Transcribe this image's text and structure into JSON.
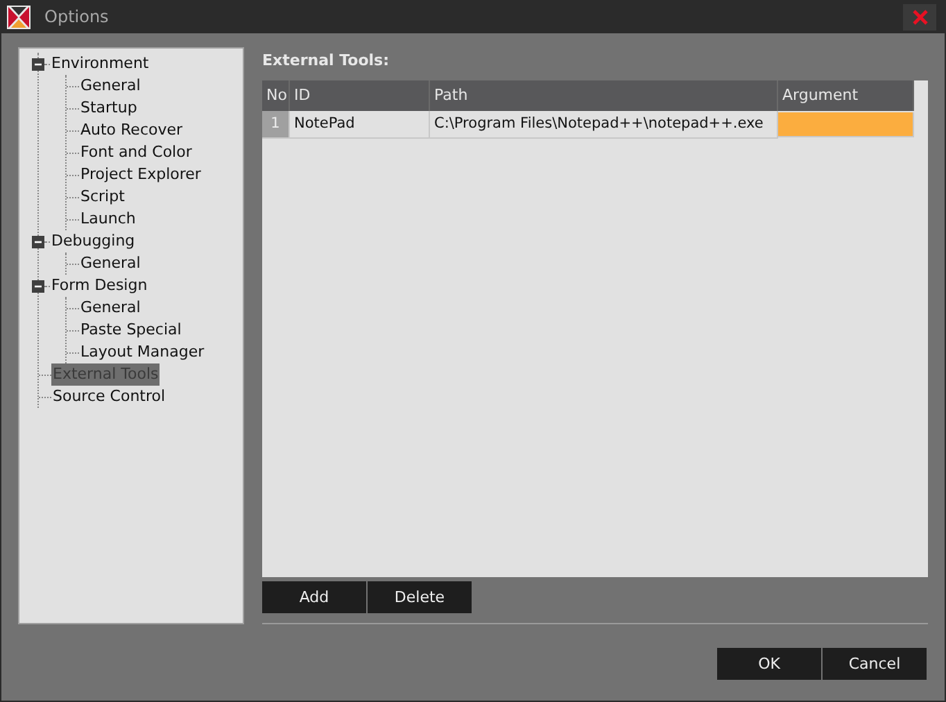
{
  "window": {
    "title": "Options"
  },
  "tree": [
    {
      "label": "Environment",
      "expanded": true,
      "selected": false,
      "children": [
        {
          "label": "General",
          "selected": false
        },
        {
          "label": "Startup",
          "selected": false
        },
        {
          "label": "Auto Recover",
          "selected": false
        },
        {
          "label": "Font and Color",
          "selected": false
        },
        {
          "label": "Project Explorer",
          "selected": false
        },
        {
          "label": "Script",
          "selected": false
        },
        {
          "label": "Launch",
          "selected": false
        }
      ]
    },
    {
      "label": "Debugging",
      "expanded": true,
      "selected": false,
      "children": [
        {
          "label": "General",
          "selected": false
        }
      ]
    },
    {
      "label": "Form Design",
      "expanded": true,
      "selected": false,
      "children": [
        {
          "label": "General",
          "selected": false
        },
        {
          "label": "Paste Special",
          "selected": false
        },
        {
          "label": "Layout Manager",
          "selected": false
        }
      ]
    },
    {
      "label": "External Tools",
      "selected": true
    },
    {
      "label": "Source Control",
      "selected": false
    }
  ],
  "section_title": "External Tools:",
  "table": {
    "columns": [
      "No",
      "ID",
      "Path",
      "Argument"
    ],
    "rows": [
      {
        "no": "1",
        "id": "NotePad",
        "path": "C:\\Program Files\\Notepad++\\notepad++.exe",
        "argument_selected": true
      }
    ]
  },
  "table_buttons": [
    "Add",
    "Delete"
  ],
  "dialog_buttons": [
    "OK",
    "Cancel"
  ]
}
